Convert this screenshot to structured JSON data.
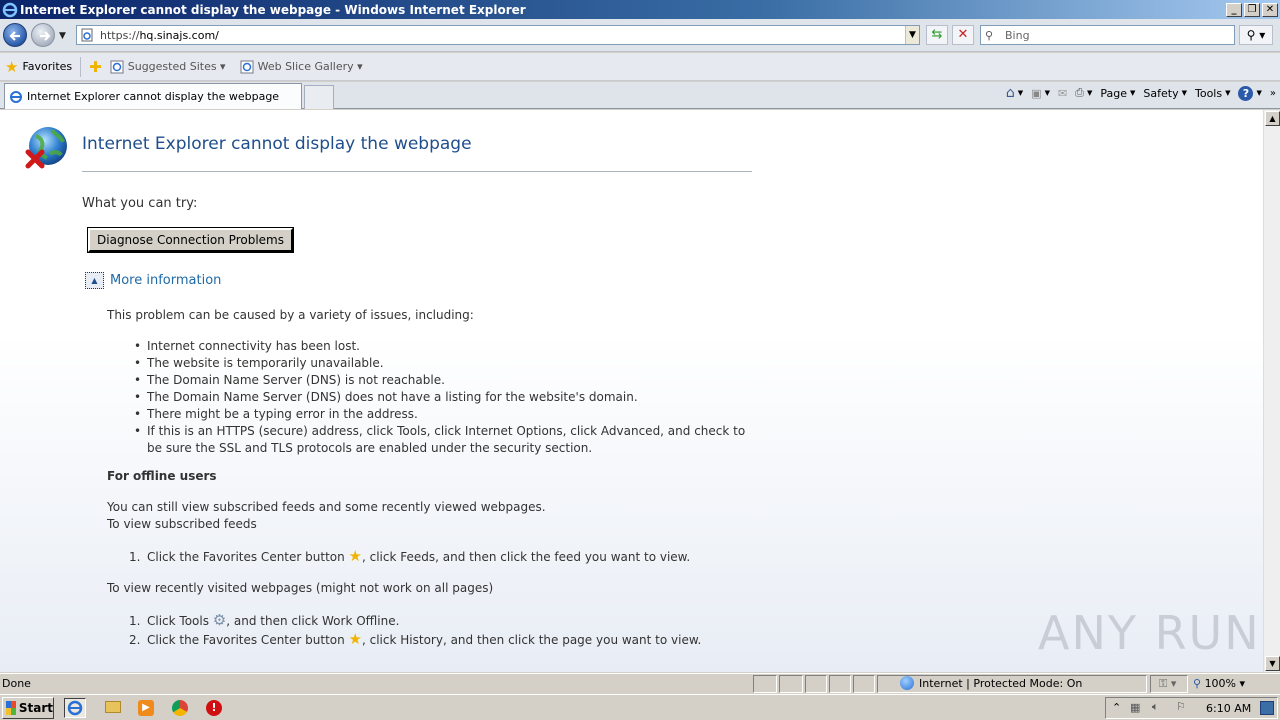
{
  "window": {
    "title": "Internet Explorer cannot display the webpage - Windows Internet Explorer"
  },
  "address_bar": {
    "url_prefix": "https://",
    "url_host": "hq.sinajs.com/"
  },
  "search": {
    "placeholder": "Bing"
  },
  "favorites_bar": {
    "favorites_label": "Favorites",
    "links": [
      {
        "label": "Suggested Sites",
        "icon": "ie-page-icon"
      },
      {
        "label": "Web Slice Gallery",
        "icon": "ie-page-icon"
      }
    ]
  },
  "tabs": [
    {
      "label": "Internet Explorer cannot display the webpage",
      "active": true
    }
  ],
  "command_bar": {
    "page_label": "Page",
    "safety_label": "Safety",
    "tools_label": "Tools"
  },
  "page": {
    "heading": "Internet Explorer cannot display the webpage",
    "what_you_can_try": "What you can try:",
    "diagnose_button": "Diagnose Connection Problems",
    "more_information": "More information",
    "cause_intro": "This problem can be caused by a variety of issues, including:",
    "issues": [
      "Internet connectivity has been lost.",
      "The website is temporarily unavailable.",
      "The Domain Name Server (DNS) is not reachable.",
      "The Domain Name Server (DNS) does not have a listing for the website's domain.",
      "There might be a typing error in the address.",
      "If this is an HTTPS (secure) address, click Tools, click Internet Options, click Advanced, and check to be sure the SSL and TLS protocols are enabled under the security section."
    ],
    "offline_heading": "For offline users",
    "offline_p1": "You can still view subscribed feeds and some recently viewed webpages.",
    "offline_p2": "To view subscribed feeds",
    "feeds_step": {
      "n": "1.",
      "before": "Click the Favorites Center button ",
      "after": ", click Feeds, and then click the feed you want to view."
    },
    "recent_heading": "To view recently visited webpages (might not work on all pages)",
    "recent_steps": [
      {
        "n": "1.",
        "before": "Click Tools ",
        "after": ", and then click Work Offline."
      },
      {
        "n": "2.",
        "before": "Click the Favorites Center button ",
        "after": ", click History, and then click the page you want to view."
      }
    ]
  },
  "watermark": "ANY RUN",
  "status_bar": {
    "status": "Done",
    "zone": "Internet | Protected Mode: On",
    "zoom": "100%"
  },
  "taskbar": {
    "start_label": "Start",
    "clock": "6:10 AM"
  },
  "colors": {
    "heading": "#1f4e8c",
    "link": "#1f6aa8",
    "titlebar_start": "#0a246a"
  }
}
